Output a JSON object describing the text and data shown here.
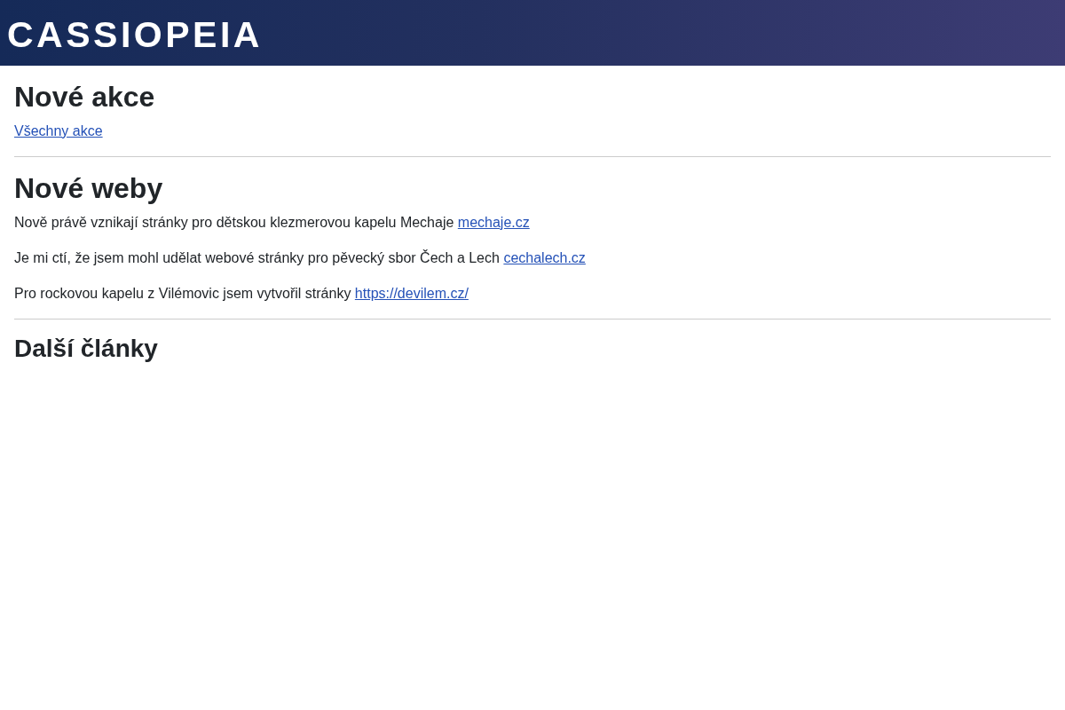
{
  "header": {
    "logo": "CASSIOPEIA"
  },
  "sections": [
    {
      "heading": "Nové akce",
      "kind": "major",
      "items": [
        {
          "link": "Všechny akce"
        }
      ]
    },
    {
      "heading": "Nové weby",
      "kind": "major",
      "items": [
        {
          "text": "Nově právě vznikají stránky pro dětskou klezmerovou kapelu Mechaje",
          "link": "mechaje.cz"
        },
        {
          "text": "Je mi ctí, že jsem mohl udělat webové stránky pro pěvecký sbor Čech a Lech",
          "link": "cechalech.cz"
        },
        {
          "text": "Pro rockovou kapelu z Vilémovic jsem vytvořil stránky",
          "link": "https://devilem.cz/"
        }
      ]
    },
    {
      "heading": "Další články",
      "kind": "minor"
    }
  ]
}
